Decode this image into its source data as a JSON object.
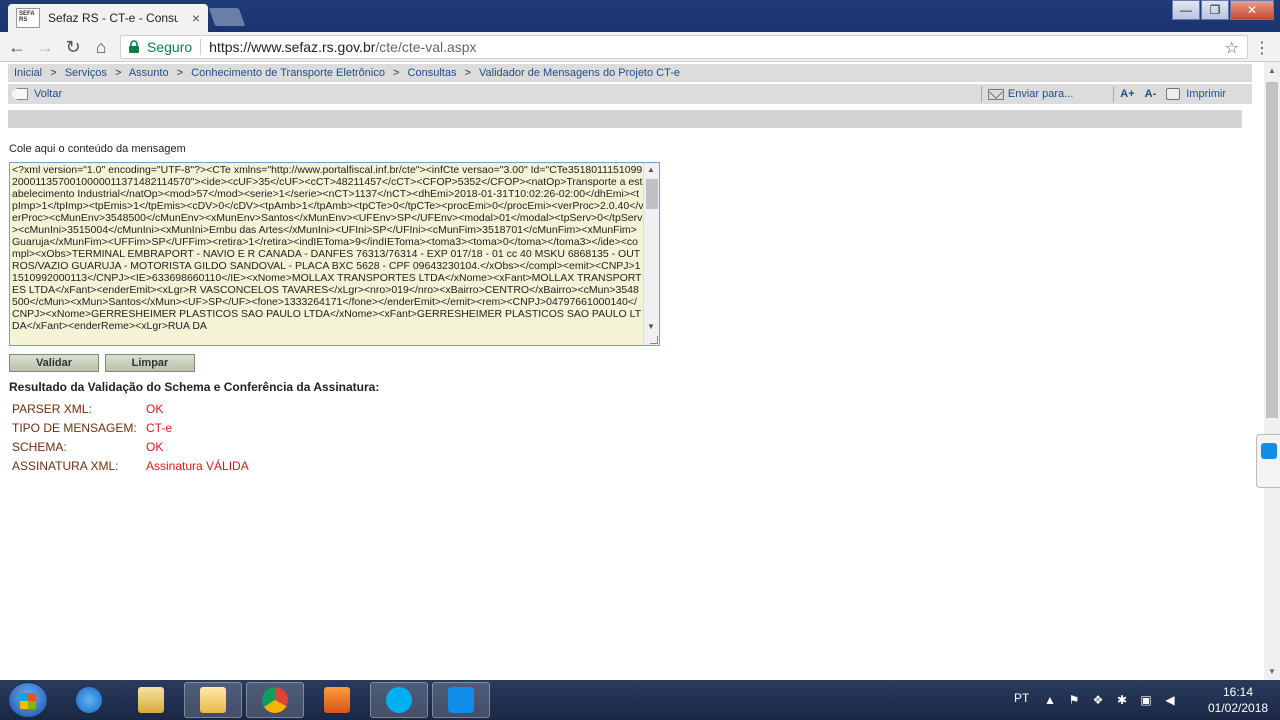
{
  "browser": {
    "tab_title": "Sefaz RS - CT-e - Consult",
    "favicon_text": "SEFA RS",
    "tab_close": "×",
    "secure_label": "Seguro",
    "url_host": "https://www.sefaz.rs.gov.br",
    "url_path": "/cte/cte-val.aspx",
    "window_min": "—",
    "window_max": "❐",
    "window_close": "✕"
  },
  "breadcrumb": [
    "Inicial",
    "Serviços",
    "Assunto",
    "Conhecimento de Transporte Eletrônico",
    "Consultas",
    "Validador de Mensagens do Projeto CT-e"
  ],
  "breadcrumb_separator": ">",
  "actions": {
    "back_label": "Voltar",
    "send_label": "Enviar para...",
    "font_increase": "A+",
    "font_decrease": "A-",
    "print_label": "Imprimir"
  },
  "form": {
    "message_label": "Cole aqui o conteúdo da mensagem",
    "message_value": "<?xml version=\"1.0\" encoding=\"UTF-8\"?><CTe xmlns=\"http://www.portalfiscal.inf.br/cte\"><infCte versao=\"3.00\" Id=\"CTe35180111510992000113570010000011371482114570\"><ide><cUF>35</cUF><cCT>48211457</cCT><CFOP>5352</CFOP><natOp>Transporte a estabelecimento Industrial</natOp><mod>57</mod><serie>1</serie><nCT>1137</nCT><dhEmi>2018-01-31T10:02:26-02:00</dhEmi><tpImp>1</tpImp><tpEmis>1</tpEmis><cDV>0</cDV><tpAmb>1</tpAmb><tpCTe>0</tpCTe><procEmi>0</procEmi><verProc>2.0.40</verProc><cMunEnv>3548500</cMunEnv><xMunEnv>Santos</xMunEnv><UFEnv>SP</UFEnv><modal>01</modal><tpServ>0</tpServ><cMunIni>3515004</cMunIni><xMunIni>Embu das Artes</xMunIni><UFIni>SP</UFIni><cMunFim>3518701</cMunFim><xMunFim>Guaruja</xMunFim><UFFim>SP</UFFim><retira>1</retira><indIEToma>9</indIEToma><toma3><toma>0</toma></toma3></ide><compl><xObs>TERMINAL EMBRAPORT - NAVIO E R CANADA - DANFES 76313/76314 - EXP 017/18 - 01 cc 40 MSKU 6868135 - OUTROS/VAZIO GUARUJA - MOTORISTA GILDO SANDOVAL - PLACA BXC 5628 - CPF 09643230104.</xObs></compl><emit><CNPJ>11510992000113</CNPJ><IE>633698660110</IE><xNome>MOLLAX TRANSPORTES LTDA</xNome><xFant>MOLLAX TRANSPORTES LTDA</xFant><enderEmit><xLgr>R VASCONCELOS TAVARES</xLgr><nro>019</nro><xBairro>CENTRO</xBairro><cMun>3548500</cMun><xMun>Santos</xMun><UF>SP</UF><fone>1333264171</fone></enderEmit></emit><rem><CNPJ>04797661000140</CNPJ><xNome>GERRESHEIMER PLASTICOS SAO PAULO LTDA</xNome><xFant>GERRESHEIMER PLASTICOS SAO PAULO LTDA</xFant><enderReme><xLgr>RUA DA",
    "validate_button": "Validar",
    "clear_button": "Limpar"
  },
  "result": {
    "title": "Resultado da Validação do Schema e Conferência da Assinatura:",
    "rows": [
      {
        "label": "PARSER XML:",
        "value": "OK"
      },
      {
        "label": "TIPO DE MENSAGEM:",
        "value": "CT-e"
      },
      {
        "label": "SCHEMA:",
        "value": "OK"
      },
      {
        "label": "ASSINATURA XML:",
        "value": "Assinatura VÁLIDA"
      }
    ]
  },
  "taskbar": {
    "language": "PT",
    "time": "16:14",
    "date": "01/02/2018"
  },
  "colors": {
    "result_label": "#6b2e0f",
    "result_value": "#d7191c",
    "link": "#1f4e8a",
    "secure": "#0b8043"
  }
}
